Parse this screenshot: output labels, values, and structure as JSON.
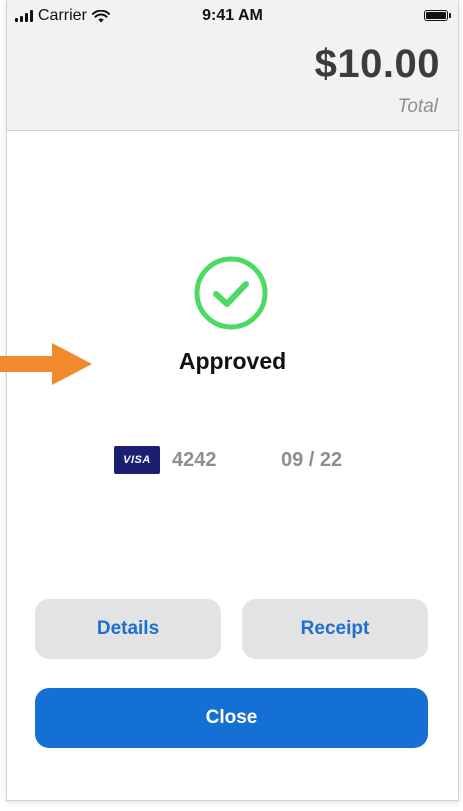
{
  "status_bar": {
    "carrier": "Carrier",
    "time": "9:41 AM"
  },
  "header": {
    "amount": "$10.00",
    "total_label": "Total"
  },
  "result": {
    "title": "Approved",
    "icon": "check-circle-icon"
  },
  "card": {
    "brand": "VISA",
    "last4": "4242",
    "expiry": "09 / 22"
  },
  "buttons": {
    "details": "Details",
    "receipt": "Receipt",
    "close": "Close"
  },
  "colors": {
    "success_green": "#4cd964",
    "primary_blue": "#1570d4",
    "link_blue": "#1e6fd0",
    "visa_navy": "#1a1f71",
    "arrow_orange": "#f08a2c"
  }
}
